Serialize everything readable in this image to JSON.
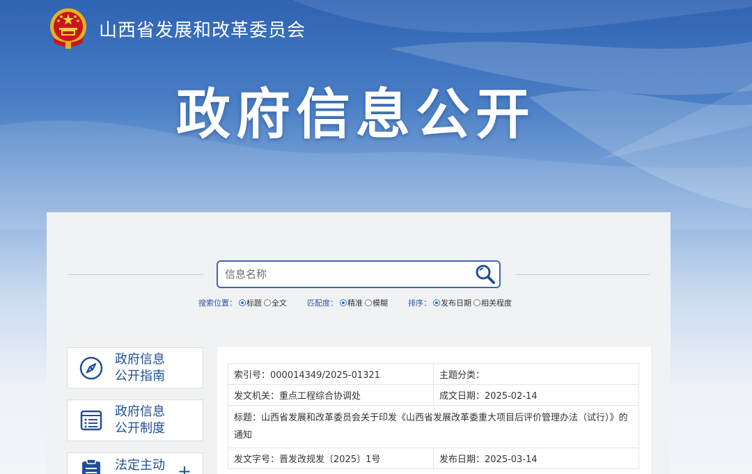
{
  "header": {
    "site_title": "山西省发展和改革委员会"
  },
  "hero": {
    "title": "政府信息公开"
  },
  "search": {
    "placeholder": "信息名称"
  },
  "options": [
    {
      "label": "搜索位置：",
      "choices": [
        {
          "text": "标题",
          "checked": true
        },
        {
          "text": "全文",
          "checked": false
        }
      ]
    },
    {
      "label": "匹配度：",
      "choices": [
        {
          "text": "精准",
          "checked": true
        },
        {
          "text": "模糊",
          "checked": false
        }
      ]
    },
    {
      "label": "排序：",
      "choices": [
        {
          "text": "发布日期",
          "checked": true
        },
        {
          "text": "相关程度",
          "checked": false
        }
      ]
    }
  ],
  "sidebar": {
    "items": [
      {
        "line1": "政府信息",
        "line2": "公开指南",
        "icon": "compass-icon"
      },
      {
        "line1": "政府信息",
        "line2": "公开制度",
        "icon": "document-list-icon"
      },
      {
        "line1": "法定主动",
        "line2": "",
        "icon": "clipboard-icon",
        "expand": "+"
      }
    ]
  },
  "info": {
    "index_no": "索引号：000014349/2025-01321",
    "topic": "主题分类：",
    "issuer": "发文机关：重点工程综合协调处",
    "created": "成文日期：2025-02-14",
    "title": "标题：山西省发展和改革委员会关于印发《山西省发展改革委重大项目后评价管理办法（试行）》的通知",
    "doc_no": "发文字号：晋发改规发〔2025〕1号",
    "published": "发布日期：2025-03-14"
  },
  "colors": {
    "brand_blue": "#2f63b3",
    "link_blue": "#1f4f97",
    "accent": "#3d67a8"
  }
}
